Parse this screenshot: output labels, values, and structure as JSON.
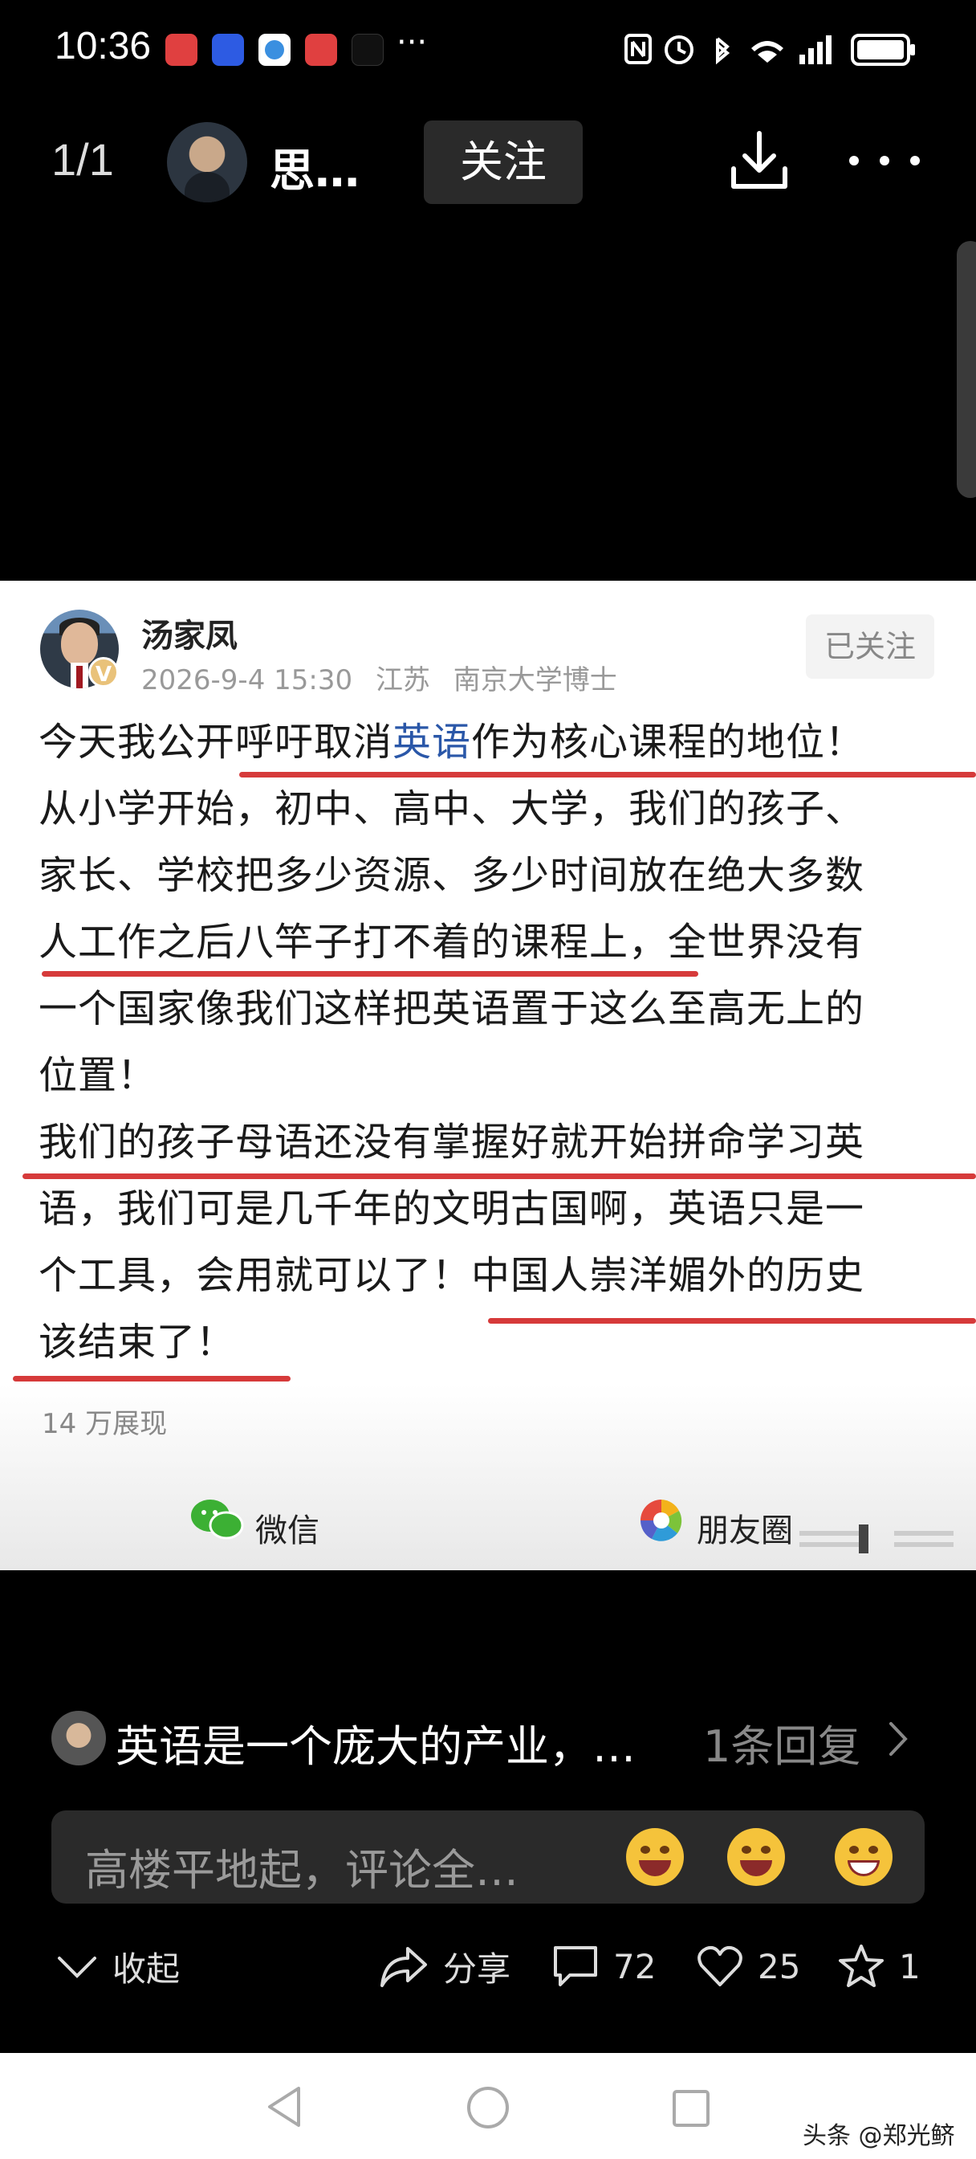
{
  "status_bar": {
    "time": "10:36",
    "overflow": "···"
  },
  "top_bar": {
    "page_counter": "1/1",
    "author_name": "思…",
    "follow_label": "关注"
  },
  "post": {
    "author": "汤家凤",
    "verified_badge": "V",
    "date": "2026-9-4 15:30",
    "location": "江苏",
    "title": "南京大学博士",
    "followed_label": "已关注",
    "lines": [
      [
        "今天我公开呼吁取消",
        "英语",
        "作为核心课程的地位！"
      ],
      "从小学开始，初中、高中、大学，我们的孩子、",
      "家长、学校把多少资源、多少时间放在绝大多数",
      "人工作之后八竿子打不着的课程上，全世界没有",
      "一个国家像我们这样把英语置于这么至高无上的",
      "位置！",
      "我们的孩子母语还没有掌握好就开始拼命学习英",
      "语，我们可是几千年的文明古国啊，英语只是一",
      "个工具，会用就可以了！中国人崇洋媚外的历史",
      "该结束了！"
    ],
    "views": "14 万展现",
    "share_wechat": "微信",
    "share_moments": "朋友圈"
  },
  "comment": {
    "text": "英语是一个庞大的产业，…",
    "reply_count": "1条回复"
  },
  "input": {
    "placeholder": "高楼平地起，评论全…"
  },
  "actions": {
    "collapse": "收起",
    "share": "分享",
    "comments": "72",
    "likes": "25",
    "favorites": "1"
  },
  "watermark": "头条 @郑光鲚",
  "colors": {
    "highlight_blue": "#2a57a8",
    "underline_red": "#d63a3a",
    "background": "#000000"
  }
}
